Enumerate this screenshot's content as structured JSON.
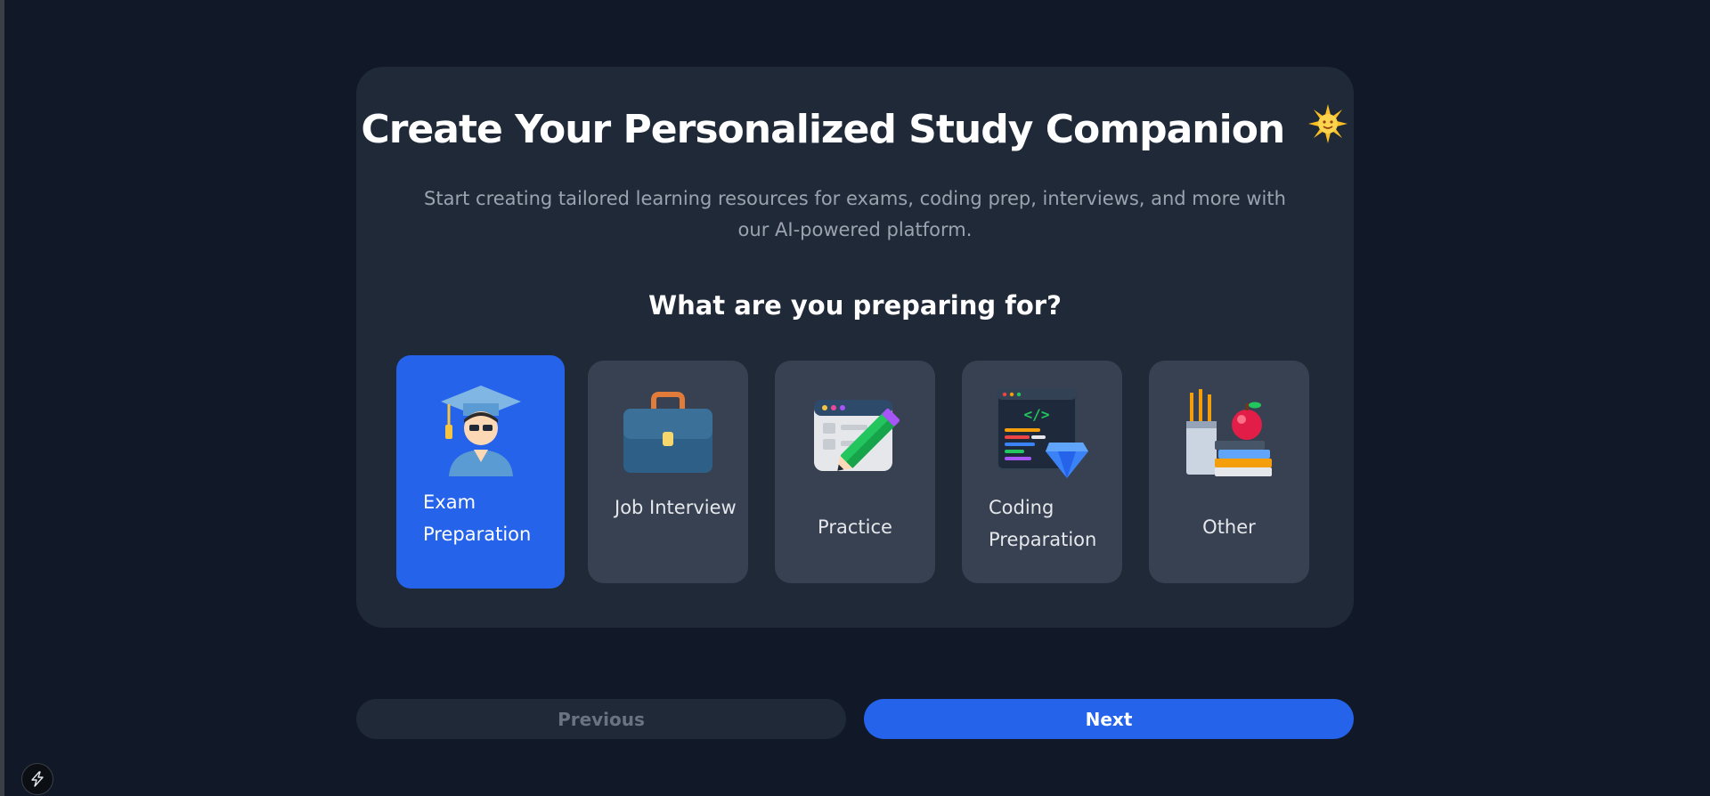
{
  "hero": {
    "title": "Create Your Personalized Study Companion",
    "title_emoji": "star-burst-icon",
    "subtitle": "Start creating tailored learning resources for exams, coding prep, interviews, and more with our AI-powered platform."
  },
  "question": "What are you preparing for?",
  "options": [
    {
      "label": "Exam Preparation",
      "icon": "graduate-icon",
      "selected": true
    },
    {
      "label": "Job Interview",
      "icon": "briefcase-icon",
      "selected": false
    },
    {
      "label": "Practice",
      "icon": "practice-pencil-icon",
      "selected": false
    },
    {
      "label": "Coding Preparation",
      "icon": "code-window-icon",
      "selected": false
    },
    {
      "label": "Other",
      "icon": "books-apple-icon",
      "selected": false
    }
  ],
  "navigation": {
    "previous_label": "Previous",
    "next_label": "Next"
  },
  "colors": {
    "background": "#111827",
    "card": "#1f2937",
    "option": "#374151",
    "accent": "#2563eb"
  }
}
